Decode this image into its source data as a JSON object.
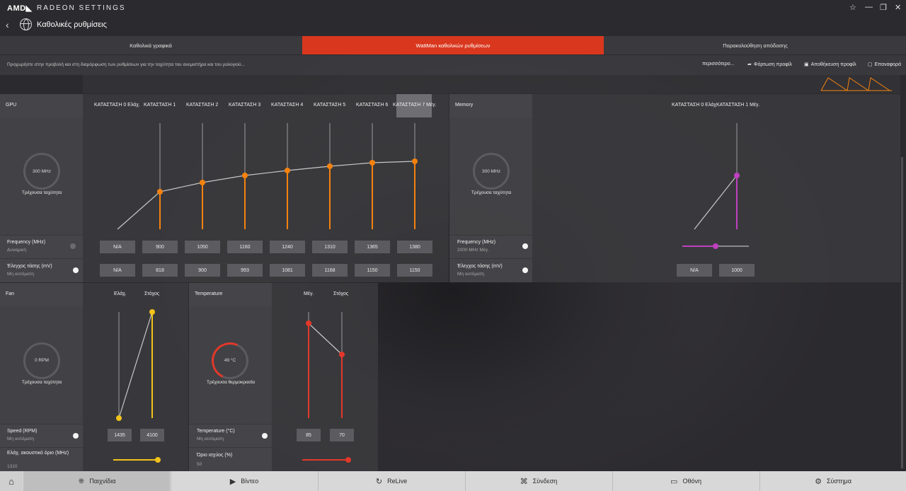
{
  "app": {
    "logo": "AMD◣",
    "title": "RADEON SETTINGS"
  },
  "window": {
    "pin": "☆",
    "minimize": "—",
    "restore": "❐",
    "close": "✕"
  },
  "nav": {
    "back": "‹",
    "page_title": "Καθολικές ρυθμίσεις"
  },
  "tabs": [
    {
      "label": "Καθολικά γραφικά"
    },
    {
      "label": "WattMan καθολικών ρυθμίσεων"
    },
    {
      "label": "Παρακολούθηση απόδοσης"
    }
  ],
  "info": {
    "text": "Προχωρήστε στην προβολή και στη διαμόρφωση των ρυθμίσεων για την ταχύτητα του ανεμιστήρα και του ρολογιού...",
    "more": "περισσότερο...",
    "load_profile": "Φόρτωση προφίλ",
    "save_profile": "Αποθήκευση προφίλ",
    "reset": "Επαναφορά"
  },
  "gpu": {
    "title": "GPU",
    "states": [
      "ΚΑΤΑΣΤΑΣΗ 0 Ελάχ.",
      "ΚΑΤΑΣΤΑΣΗ 1",
      "ΚΑΤΑΣΤΑΣΗ 2",
      "ΚΑΤΑΣΤΑΣΗ 3",
      "ΚΑΤΑΣΤΑΣΗ 4",
      "ΚΑΤΑΣΤΑΣΗ 5",
      "ΚΑΤΑΣΤΑΣΗ 6",
      "ΚΑΤΑΣΤΑΣΗ 7 Μέγ."
    ],
    "gauge_value": "300 MHz",
    "gauge_label": "Τρέχουσα ταχύτητα",
    "frequency_label": "Frequency (MHz)",
    "frequency_sub": "Δυναμική",
    "frequency_values": [
      "N/A",
      "900",
      "1050",
      "1160",
      "1240",
      "1310",
      "1365",
      "1380"
    ],
    "voltage_label": "Έλεγχος τάσης (mV)",
    "voltage_sub": "Μη αυτόματη",
    "voltage_values": [
      "N/A",
      "818",
      "900",
      "993",
      "1081",
      "1168",
      "1150",
      "1150"
    ]
  },
  "memory": {
    "title": "Memory",
    "states": "ΚΑΤΑΣΤΑΣΗ 0 ΕλάχΚΑΤΑΣΤΑΣΗ 1 Μέγ.",
    "gauge_value": "300 MHz",
    "gauge_label": "Τρέχουσα ταχύτητα",
    "frequency_label": "Frequency (MHz)",
    "frequency_sub": "2000 MHz Μέγ.",
    "frequency_slider": 0.5,
    "voltage_label": "Έλεγχος τάσης (mV)",
    "voltage_sub": "Μη αυτόματη",
    "voltage_values": [
      "N/A",
      "1000"
    ]
  },
  "fan": {
    "title": "Fan",
    "col_min": "Ελάχ.",
    "col_target": "Στόχος",
    "gauge_value": "0 RPM",
    "gauge_label": "Τρέχουσα ταχύτητα",
    "speed_label": "Speed (RPM)",
    "speed_sub": "Μη αυτόματη",
    "speed_values": [
      "1435",
      "4100"
    ],
    "acoustic_label": "Ελάχ. ακουστικό όριο (MHz)",
    "acoustic_value": "1310",
    "acoustic_slider": 0.95
  },
  "temperature": {
    "title": "Temperature",
    "col_max": "Μέγ.",
    "col_target": "Στόχος",
    "gauge_value": "49 °C",
    "gauge_label": "Τρέχουσα θερμοκρασία",
    "temp_label": "Temperature (°C)",
    "temp_sub": "Μη αυτόματη",
    "temp_values": [
      "85",
      "70"
    ],
    "power_label": "Όριο ισχύος (%)",
    "power_value": "50",
    "power_slider": 0.95
  },
  "bottom": [
    {
      "label": "",
      "icon": "home-icon"
    },
    {
      "label": "Παιχνίδια",
      "icon": "gamepad-icon"
    },
    {
      "label": "Βίντεο",
      "icon": "play-icon"
    },
    {
      "label": "ReLive",
      "icon": "relive-icon"
    },
    {
      "label": "Σύνδεση",
      "icon": "connect-icon"
    },
    {
      "label": "Οθόνη",
      "icon": "monitor-icon"
    },
    {
      "label": "Σύστημα",
      "icon": "system-icon"
    }
  ],
  "colors": {
    "accent": "#d9381e",
    "gpu_line": "#f5820f",
    "memory_line": "#c040c0",
    "fan_line": "#f2c21a",
    "temp_line": "#e2382a"
  }
}
